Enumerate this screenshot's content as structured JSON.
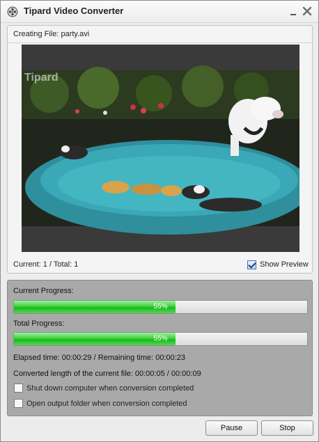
{
  "window": {
    "title": "Tipard Video Converter",
    "icons": {
      "app": "film-reel-icon",
      "minimize": "minimize-icon",
      "close": "close-icon"
    }
  },
  "status": {
    "creating_file": "Creating File: party.avi",
    "count": "Current: 1 / Total: 1"
  },
  "preview": {
    "watermark": "Tipard",
    "show_preview_label": "Show Preview",
    "show_preview_checked": true
  },
  "progress": {
    "current_label": "Current Progress:",
    "current_value": 0.55,
    "current_text": "55%",
    "total_label": "Total Progress:",
    "total_value": 0.55,
    "total_text": "55%",
    "elapsed_text": "Elapsed time: 00:00:29 / Remaining time: 00:00:23",
    "converted_text": "Converted length of the current file: 00:00:05 / 00:00:09"
  },
  "options": [
    {
      "label": "Shut down computer when conversion completed",
      "checked": false
    },
    {
      "label": "Open output folder when conversion completed",
      "checked": false
    }
  ],
  "buttons": {
    "pause": "Pause",
    "stop": "Stop"
  },
  "colors": {
    "progress_fill": "#3dd33d",
    "pool_water": "#39a8b6",
    "bottom_panel": "#a9a9a9"
  }
}
